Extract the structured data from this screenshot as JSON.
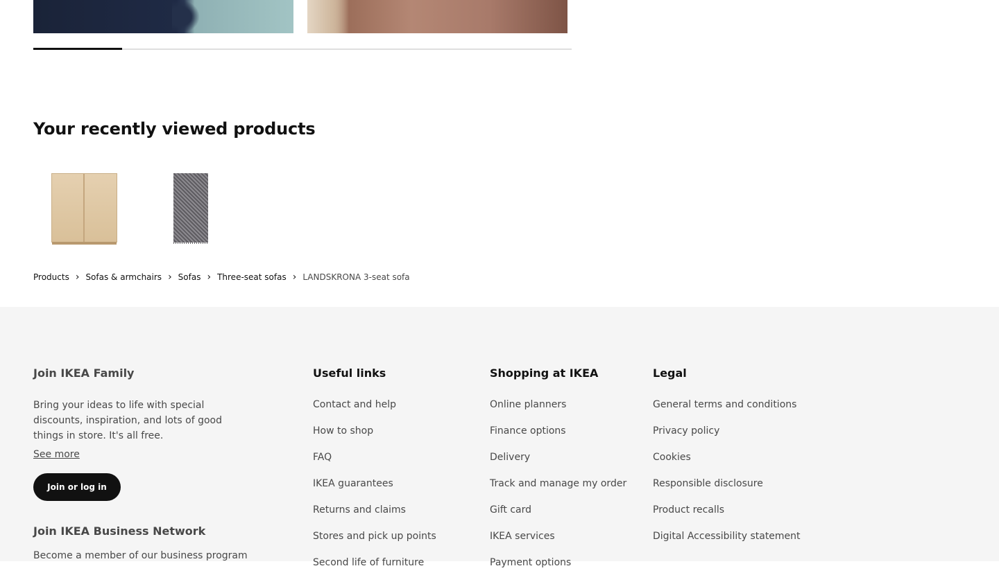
{
  "recent": {
    "title": "Your recently viewed products",
    "items": [
      {
        "icon": "wood-cabinet-thumbnail"
      },
      {
        "icon": "grey-rug-thumbnail"
      }
    ]
  },
  "breadcrumb": {
    "items": [
      "Products",
      "Sofas & armchairs",
      "Sofas",
      "Three-seat sofas"
    ],
    "current": "LANDSKRONA 3-seat sofa"
  },
  "footer": {
    "family": {
      "title": "Join IKEA Family",
      "text": "Bring your ideas to life with special discounts, inspiration, and lots of good things in store. It's all free.",
      "see_more": "See more",
      "button": "Join or log in"
    },
    "business": {
      "title": "Join IKEA Business Network",
      "text": "Become a member of our business program"
    },
    "useful_links": {
      "title": "Useful links",
      "items": [
        "Contact and help",
        "How to shop",
        "FAQ",
        "IKEA guarantees",
        "Returns and claims",
        "Stores and pick up points",
        "Second life of furniture"
      ]
    },
    "shopping": {
      "title": "Shopping at IKEA",
      "items": [
        "Online planners",
        "Finance options",
        "Delivery",
        "Track and manage my order",
        "Gift card",
        "IKEA services",
        "Payment options"
      ]
    },
    "legal": {
      "title": "Legal",
      "items": [
        "General terms and conditions",
        "Privacy policy",
        "Cookies",
        "Responsible disclosure",
        "Product recalls",
        "Digital Accessibility statement"
      ]
    }
  },
  "colors": {
    "text": "#111111",
    "muted": "#484848",
    "footer_bg": "#f5f5f5",
    "button_bg": "#111111"
  }
}
